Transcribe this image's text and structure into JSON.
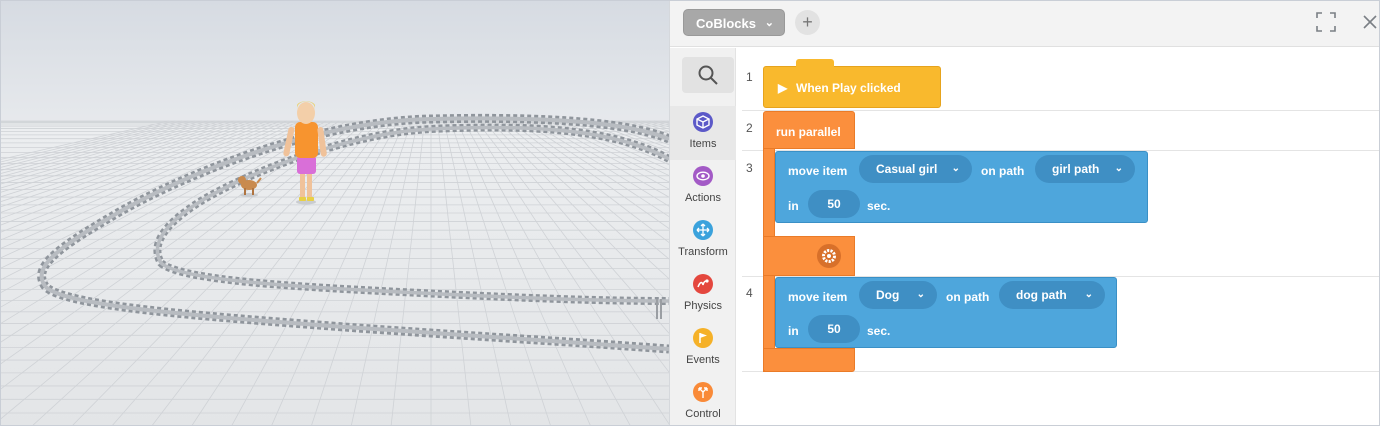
{
  "toolbar": {
    "project_name": "CoBlocks",
    "add_label": "+"
  },
  "categories": [
    {
      "id": "items",
      "label": "Items",
      "color": "#5c59c8",
      "icon": "cube-icon"
    },
    {
      "id": "actions",
      "label": "Actions",
      "color": "#a35ac6",
      "icon": "eye-icon"
    },
    {
      "id": "transform",
      "label": "Transform",
      "color": "#3ba2dc",
      "icon": "move-arrows-icon"
    },
    {
      "id": "physics",
      "label": "Physics",
      "color": "#e4473e",
      "icon": "physics-icon"
    },
    {
      "id": "events",
      "label": "Events",
      "color": "#f5b128",
      "icon": "flag-icon"
    },
    {
      "id": "control",
      "label": "Control",
      "color": "#f98a38",
      "icon": "branch-icon"
    }
  ],
  "code": {
    "line_numbers": [
      "1",
      "2",
      "3",
      "4"
    ],
    "hat": {
      "label": "When Play clicked"
    },
    "parallel": {
      "label": "run parallel"
    },
    "move1": {
      "prefix": "move item",
      "item": "Casual girl",
      "path_label": "on path",
      "path": "girl path",
      "in_label": "in",
      "duration": "50",
      "unit": "sec."
    },
    "move2": {
      "prefix": "move item",
      "item": "Dog",
      "path_label": "on path",
      "path": "dog path",
      "in_label": "in",
      "duration": "50",
      "unit": "sec."
    }
  },
  "colors": {
    "hat": "#f9b92d",
    "control": "#fb8f3d",
    "transform": "#4ea6dc"
  }
}
